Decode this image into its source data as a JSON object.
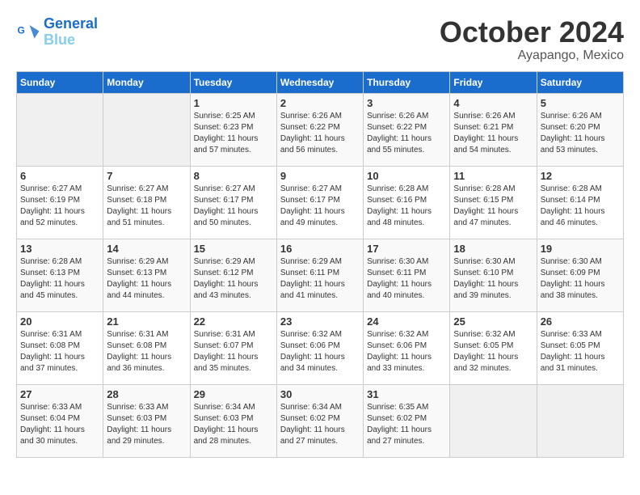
{
  "header": {
    "logo_line1": "General",
    "logo_line2": "Blue",
    "month": "October 2024",
    "location": "Ayapango, Mexico"
  },
  "days_of_week": [
    "Sunday",
    "Monday",
    "Tuesday",
    "Wednesday",
    "Thursday",
    "Friday",
    "Saturday"
  ],
  "weeks": [
    [
      {
        "day": "",
        "sunrise": "",
        "sunset": "",
        "daylight": "",
        "empty": true
      },
      {
        "day": "",
        "sunrise": "",
        "sunset": "",
        "daylight": "",
        "empty": true
      },
      {
        "day": "1",
        "sunrise": "Sunrise: 6:25 AM",
        "sunset": "Sunset: 6:23 PM",
        "daylight": "Daylight: 11 hours and 57 minutes."
      },
      {
        "day": "2",
        "sunrise": "Sunrise: 6:26 AM",
        "sunset": "Sunset: 6:22 PM",
        "daylight": "Daylight: 11 hours and 56 minutes."
      },
      {
        "day": "3",
        "sunrise": "Sunrise: 6:26 AM",
        "sunset": "Sunset: 6:22 PM",
        "daylight": "Daylight: 11 hours and 55 minutes."
      },
      {
        "day": "4",
        "sunrise": "Sunrise: 6:26 AM",
        "sunset": "Sunset: 6:21 PM",
        "daylight": "Daylight: 11 hours and 54 minutes."
      },
      {
        "day": "5",
        "sunrise": "Sunrise: 6:26 AM",
        "sunset": "Sunset: 6:20 PM",
        "daylight": "Daylight: 11 hours and 53 minutes."
      }
    ],
    [
      {
        "day": "6",
        "sunrise": "Sunrise: 6:27 AM",
        "sunset": "Sunset: 6:19 PM",
        "daylight": "Daylight: 11 hours and 52 minutes."
      },
      {
        "day": "7",
        "sunrise": "Sunrise: 6:27 AM",
        "sunset": "Sunset: 6:18 PM",
        "daylight": "Daylight: 11 hours and 51 minutes."
      },
      {
        "day": "8",
        "sunrise": "Sunrise: 6:27 AM",
        "sunset": "Sunset: 6:17 PM",
        "daylight": "Daylight: 11 hours and 50 minutes."
      },
      {
        "day": "9",
        "sunrise": "Sunrise: 6:27 AM",
        "sunset": "Sunset: 6:17 PM",
        "daylight": "Daylight: 11 hours and 49 minutes."
      },
      {
        "day": "10",
        "sunrise": "Sunrise: 6:28 AM",
        "sunset": "Sunset: 6:16 PM",
        "daylight": "Daylight: 11 hours and 48 minutes."
      },
      {
        "day": "11",
        "sunrise": "Sunrise: 6:28 AM",
        "sunset": "Sunset: 6:15 PM",
        "daylight": "Daylight: 11 hours and 47 minutes."
      },
      {
        "day": "12",
        "sunrise": "Sunrise: 6:28 AM",
        "sunset": "Sunset: 6:14 PM",
        "daylight": "Daylight: 11 hours and 46 minutes."
      }
    ],
    [
      {
        "day": "13",
        "sunrise": "Sunrise: 6:28 AM",
        "sunset": "Sunset: 6:13 PM",
        "daylight": "Daylight: 11 hours and 45 minutes."
      },
      {
        "day": "14",
        "sunrise": "Sunrise: 6:29 AM",
        "sunset": "Sunset: 6:13 PM",
        "daylight": "Daylight: 11 hours and 44 minutes."
      },
      {
        "day": "15",
        "sunrise": "Sunrise: 6:29 AM",
        "sunset": "Sunset: 6:12 PM",
        "daylight": "Daylight: 11 hours and 43 minutes."
      },
      {
        "day": "16",
        "sunrise": "Sunrise: 6:29 AM",
        "sunset": "Sunset: 6:11 PM",
        "daylight": "Daylight: 11 hours and 41 minutes."
      },
      {
        "day": "17",
        "sunrise": "Sunrise: 6:30 AM",
        "sunset": "Sunset: 6:11 PM",
        "daylight": "Daylight: 11 hours and 40 minutes."
      },
      {
        "day": "18",
        "sunrise": "Sunrise: 6:30 AM",
        "sunset": "Sunset: 6:10 PM",
        "daylight": "Daylight: 11 hours and 39 minutes."
      },
      {
        "day": "19",
        "sunrise": "Sunrise: 6:30 AM",
        "sunset": "Sunset: 6:09 PM",
        "daylight": "Daylight: 11 hours and 38 minutes."
      }
    ],
    [
      {
        "day": "20",
        "sunrise": "Sunrise: 6:31 AM",
        "sunset": "Sunset: 6:08 PM",
        "daylight": "Daylight: 11 hours and 37 minutes."
      },
      {
        "day": "21",
        "sunrise": "Sunrise: 6:31 AM",
        "sunset": "Sunset: 6:08 PM",
        "daylight": "Daylight: 11 hours and 36 minutes."
      },
      {
        "day": "22",
        "sunrise": "Sunrise: 6:31 AM",
        "sunset": "Sunset: 6:07 PM",
        "daylight": "Daylight: 11 hours and 35 minutes."
      },
      {
        "day": "23",
        "sunrise": "Sunrise: 6:32 AM",
        "sunset": "Sunset: 6:06 PM",
        "daylight": "Daylight: 11 hours and 34 minutes."
      },
      {
        "day": "24",
        "sunrise": "Sunrise: 6:32 AM",
        "sunset": "Sunset: 6:06 PM",
        "daylight": "Daylight: 11 hours and 33 minutes."
      },
      {
        "day": "25",
        "sunrise": "Sunrise: 6:32 AM",
        "sunset": "Sunset: 6:05 PM",
        "daylight": "Daylight: 11 hours and 32 minutes."
      },
      {
        "day": "26",
        "sunrise": "Sunrise: 6:33 AM",
        "sunset": "Sunset: 6:05 PM",
        "daylight": "Daylight: 11 hours and 31 minutes."
      }
    ],
    [
      {
        "day": "27",
        "sunrise": "Sunrise: 6:33 AM",
        "sunset": "Sunset: 6:04 PM",
        "daylight": "Daylight: 11 hours and 30 minutes."
      },
      {
        "day": "28",
        "sunrise": "Sunrise: 6:33 AM",
        "sunset": "Sunset: 6:03 PM",
        "daylight": "Daylight: 11 hours and 29 minutes."
      },
      {
        "day": "29",
        "sunrise": "Sunrise: 6:34 AM",
        "sunset": "Sunset: 6:03 PM",
        "daylight": "Daylight: 11 hours and 28 minutes."
      },
      {
        "day": "30",
        "sunrise": "Sunrise: 6:34 AM",
        "sunset": "Sunset: 6:02 PM",
        "daylight": "Daylight: 11 hours and 27 minutes."
      },
      {
        "day": "31",
        "sunrise": "Sunrise: 6:35 AM",
        "sunset": "Sunset: 6:02 PM",
        "daylight": "Daylight: 11 hours and 27 minutes."
      },
      {
        "day": "",
        "sunrise": "",
        "sunset": "",
        "daylight": "",
        "empty": true
      },
      {
        "day": "",
        "sunrise": "",
        "sunset": "",
        "daylight": "",
        "empty": true
      }
    ]
  ]
}
